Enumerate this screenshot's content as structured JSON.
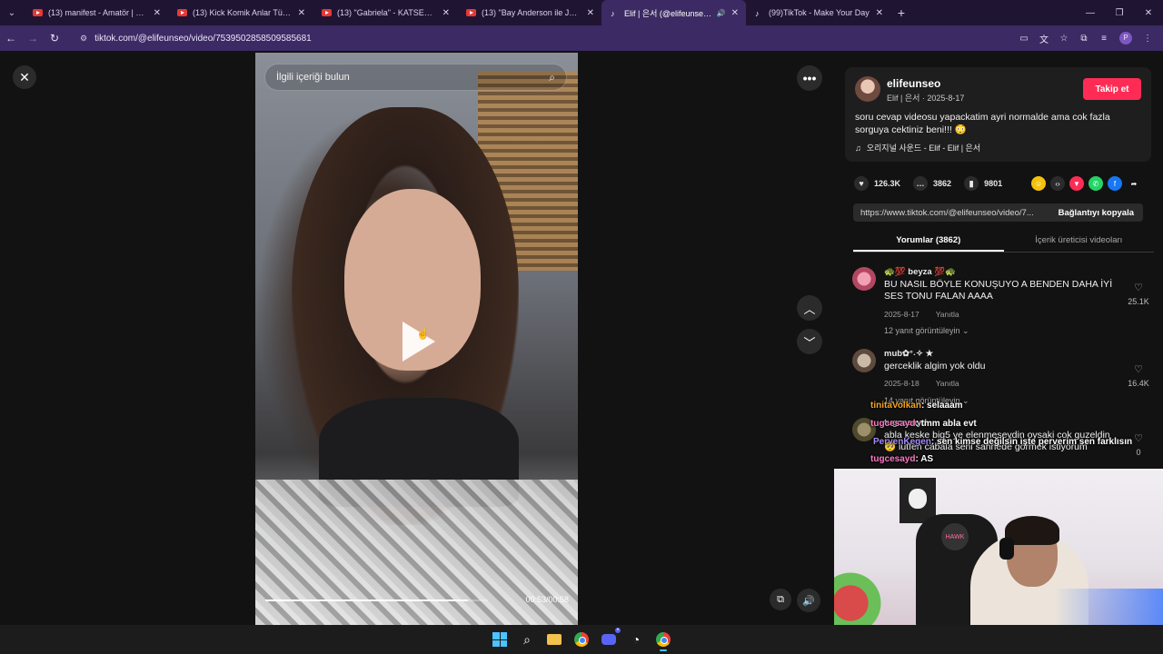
{
  "browser": {
    "tabs": [
      {
        "title": "(13) manifest - Amatör | Official",
        "type": "youtube"
      },
      {
        "title": "(13) Kick Komik Anlar Türkiye R",
        "type": "youtube"
      },
      {
        "title": "(13) \"Gabriela\" - KATSEYE - You",
        "type": "youtube"
      },
      {
        "title": "(13) \"Bay Anderson ile John W",
        "type": "youtube"
      },
      {
        "title": "Elif | 은서 (@elifeunseo) | Ti",
        "type": "tiktok",
        "active": true
      },
      {
        "title": "(99)TikTok - Make Your Day",
        "type": "tiktok"
      }
    ],
    "url": "tiktok.com/@elifeunseo/video/7539502858509585681",
    "profile_initial": "P"
  },
  "video": {
    "search_placeholder": "İlgili içeriği bulun",
    "time": "00:53/00:58",
    "progress": 0.91
  },
  "author": {
    "username": "elifeunseo",
    "display": "Elif | 은서 · 2025-8-17",
    "follow_label": "Takip et",
    "description": "soru cevap videosu yapackatim ayri normalde ama cok fazla sorguya cektiniz beni!!! 😳",
    "music": "오리지널 사운드 - Elif - Elif | 은서"
  },
  "stats": {
    "likes": "126.3K",
    "comments": "3862",
    "saves": "9801"
  },
  "link": {
    "url": "https://www.tiktok.com/@elifeunseo/video/7...",
    "copy_label": "Bağlantıyı kopyala"
  },
  "tabs": {
    "comments": "Yorumlar (3862)",
    "creator_videos": "İçerik üreticisi videoları"
  },
  "comments": [
    {
      "name": "🐢💯 beyza 💯🐢",
      "text": "BU NASIL BÖYLE KONUŞUYO A BENDEN DAHA İYİ SES TONU FALAN AAAA",
      "date": "2025-8-17",
      "reply": "Yanıtla",
      "replies": "12 yanıt görüntüleyin ⌄",
      "likes": "25.1K"
    },
    {
      "name": "mub✿°˖✧ ★",
      "text": "gerceklik algim yok oldu",
      "date": "2025-8-18",
      "reply": "Yanıtla",
      "replies": "14 yanıt görüntüleyin ⌄",
      "likes": "16.4K"
    },
    {
      "name": "tugcesayd",
      "text": "abla keske big5 ye elenmeseydin oysaki cok guzeldin 🥺 lutfen cabala seni sahnede gormek istiyorum",
      "likes": "0"
    }
  ],
  "chat": [
    {
      "user": "tinitaVolkan",
      "text": ": selaaam"
    },
    {
      "user": "tugcesayd",
      "text": ": tmm abla evt"
    },
    {
      "user": "PervenKegen",
      "text": ": sen kimse değilsin işte perverim sen farklısın"
    },
    {
      "user": "tugcesayd",
      "text": ": AS"
    }
  ],
  "colors": {
    "accent": "#fe2c55",
    "browser_bg": "#1f1533",
    "browser_active": "#3b2a63"
  }
}
